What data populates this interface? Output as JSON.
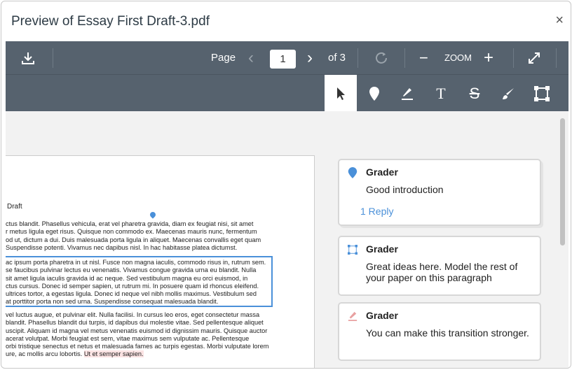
{
  "window": {
    "title": "Preview of Essay First Draft-3.pdf",
    "close": "×"
  },
  "toolbar": {
    "page_label": "Page",
    "page_value": "1",
    "of_label": "of 3",
    "zoom_label": "ZOOM",
    "prev": "‹",
    "next": "›",
    "minus": "−",
    "plus": "+"
  },
  "tools": [
    "select",
    "point",
    "highlight",
    "text",
    "strikeout",
    "freedraw",
    "area"
  ],
  "document": {
    "heading": "Draft",
    "para1": [
      "ctus blandit. Phasellus vehicula, erat vel pharetra gravida, diam ex feugiat nisi, sit amet",
      "r metus ligula eget risus. Quisque non commodo ex. Maecenas mauris nunc, fermentum",
      "od ut, dictum a dui. Duis malesuada porta ligula in aliquet. Maecenas convallis eget quam",
      " Suspendisse potenti. Vivamus nec dapibus nisl. In hac habitasse platea dictumst."
    ],
    "para2": [
      "ac ipsum porta pharetra in ut nisl. Fusce non magna iaculis, commodo risus in, rutrum sem.",
      "se faucibus pulvinar lectus eu venenatis. Vivamus congue gravida urna eu blandit. Nulla",
      "sit amet ligula iaculis gravida id ac neque. Sed vestibulum magna eu orci euismod, in",
      "ctus cursus. Donec id semper sapien, ut rutrum mi. In posuere quam id rhoncus eleifend.",
      "ultrices tortor, a egestas ligula. Donec id neque vel nibh mollis maximus. Vestibulum sed",
      "at porttitor porta non sed urna. Suspendisse consequat malesuada blandit."
    ],
    "para3": [
      " vel luctus augue, et pulvinar elit. Nulla facilisi. In cursus leo eros, eget consectetur massa",
      " blandit. Phasellus blandit dui turpis, id dapibus dui molestie vitae. Sed pellentesque aliquet",
      "uscipit. Aliquam id magna vel metus venenatis euismod id dignissim mauris. Quisque auctor",
      "acerat volutpat. Morbi feugiat est sem, vitae maximus sem vulputate ac. Pellentesque",
      "orbi tristique senectus et netus et malesuada fames ac turpis egestas. Morbi vulputate lorem"
    ],
    "para3_last_plain": "ure, ac mollis arcu lobortis. ",
    "para3_last_marked": "Ut et semper sapien."
  },
  "comments": [
    {
      "author": "Grader",
      "text": "Good introduction",
      "reply": "1 Reply",
      "icon": "point-icon",
      "color": "#4a90d9"
    },
    {
      "author": "Grader",
      "text": "Great ideas here. Model the rest of your paper on this paragraph",
      "icon": "area-icon",
      "color": "#4a90d9"
    },
    {
      "author": "Grader",
      "text": "You can make this transition stronger.",
      "icon": "highlight-icon",
      "color": "#e8a0a0"
    }
  ]
}
